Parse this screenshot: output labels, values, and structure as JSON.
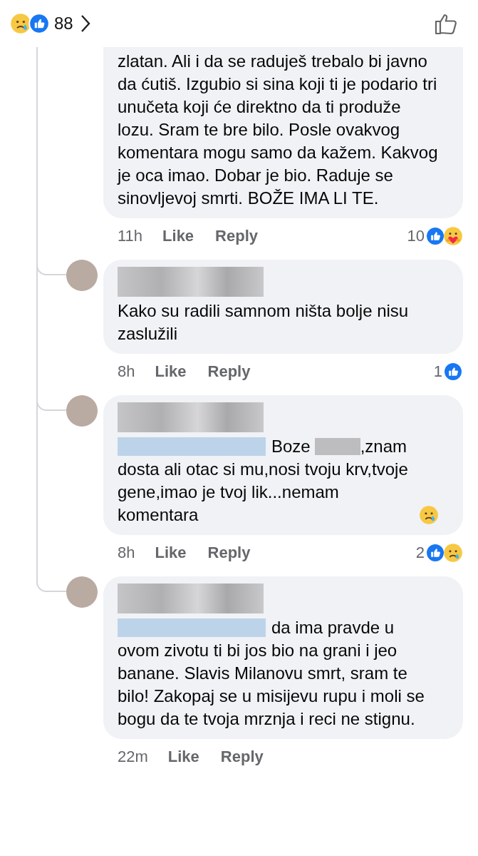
{
  "header": {
    "reactions": [
      {
        "kind": "sad"
      },
      {
        "kind": "like"
      }
    ],
    "count": "88"
  },
  "comments": [
    {
      "cut_top": true,
      "avatar": false,
      "rows": [
        [
          {
            "kind": "text",
            "text": "zlatan. Ali i da se raduješ trebalo bi javno da ćutiš.  Izgubio si sina koji ti je podario tri unučeta koji će direktno da ti produže lozu. Sram te bre bilo. Posle ovakvog komentara mogu samo da kažem. Kakvog je oca imao. Dobar je bio. Raduje se sinovljevoj smrti. BOŽE IMA LI TE."
          }
        ]
      ],
      "time": "11h",
      "like": "Like",
      "reply": "Reply",
      "count": "10",
      "reactions": [
        {
          "kind": "like"
        },
        {
          "kind": "care"
        }
      ]
    },
    {
      "cut_top": false,
      "avatar": true,
      "rows": [
        [
          {
            "kind": "text",
            "text": "Kako su radili samnom ništa bolje nisu zaslužili"
          }
        ]
      ],
      "time": "8h",
      "like": "Like",
      "reply": "Reply",
      "count": "1",
      "reactions": [
        {
          "kind": "like"
        }
      ]
    },
    {
      "cut_top": false,
      "avatar": true,
      "rows": [
        [
          {
            "kind": "mention"
          },
          {
            "kind": "text",
            "text": "Boze"
          },
          {
            "kind": "redacted"
          },
          {
            "kind": "text",
            "text": ",znam"
          }
        ],
        [
          {
            "kind": "text",
            "text": "dosta ali otac si mu,nosi tvoju krv,tvoje gene,imao je tvoj lik...nemam komentara"
          },
          {
            "kind": "emoji"
          }
        ]
      ],
      "time": "8h",
      "like": "Like",
      "reply": "Reply",
      "count": "2",
      "reactions": [
        {
          "kind": "like"
        },
        {
          "kind": "sad"
        }
      ]
    },
    {
      "cut_top": false,
      "avatar": true,
      "rows": [
        [
          {
            "kind": "mention"
          },
          {
            "kind": "text",
            "text": "da ima pravde u"
          }
        ],
        [
          {
            "kind": "text",
            "text": "ovom zivotu ti bi jos bio na grani i jeo banane. Slavis Milanovu smrt, sram te bilo! Zakopaj se u misijevu rupu i moli se bogu da te tvoja mrznja i reci ne stignu."
          }
        ]
      ],
      "time": "22m",
      "like": "Like",
      "reply": "Reply"
    }
  ]
}
